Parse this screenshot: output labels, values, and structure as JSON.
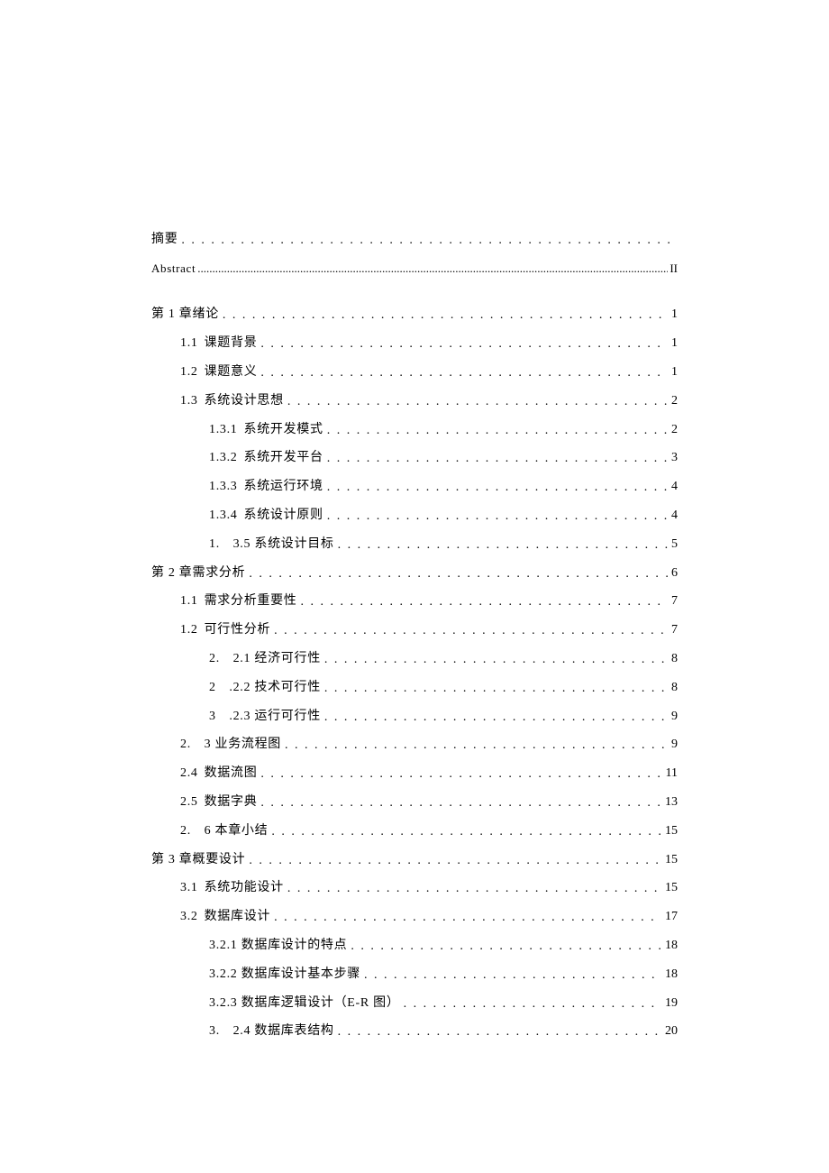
{
  "toc": [
    {
      "level": 0,
      "label": "摘要",
      "title": "",
      "page": "",
      "dots": "sparse",
      "gap": false
    },
    {
      "level": 0,
      "label": "Abstract",
      "title": "",
      "page": "II",
      "dots": "dense",
      "gap": true,
      "cls": "abstract-line"
    },
    {
      "level": 0,
      "label": "第 1 章绪论",
      "title": "",
      "page": "1",
      "dots": "sparse",
      "gap": false
    },
    {
      "level": 1,
      "label": "1.1",
      "title": "课题背景",
      "page": "1",
      "dots": "sparse",
      "gap": false
    },
    {
      "level": 1,
      "label": "1.2",
      "title": "课题意义",
      "page": "1",
      "dots": "sparse",
      "gap": false
    },
    {
      "level": 1,
      "label": "1.3",
      "title": "系统设计思想",
      "page": "2",
      "dots": "sparse",
      "gap": false
    },
    {
      "level": 2,
      "label": "1.3.1",
      "title": "系统开发模式",
      "page": "2",
      "dots": "sparse",
      "gap": false
    },
    {
      "level": 2,
      "label": "1.3.2",
      "title": "系统开发平台",
      "page": "3",
      "dots": "sparse",
      "gap": false
    },
    {
      "level": 2,
      "label": "1.3.3",
      "title": "系统运行环境",
      "page": "4",
      "dots": "sparse",
      "gap": false
    },
    {
      "level": 2,
      "label": "1.3.4",
      "title": "系统设计原则",
      "page": "4",
      "dots": "sparse",
      "gap": false
    },
    {
      "level": 2,
      "label": "1. 3.5 系统设计目标",
      "title": "",
      "page": "5",
      "dots": "sparse",
      "gap": false
    },
    {
      "level": 0,
      "label": "第 2 章需求分析",
      "title": "",
      "page": "6",
      "dots": "sparse",
      "gap": false
    },
    {
      "level": 1,
      "label": "1.1",
      "title": "需求分析重要性",
      "page": "7",
      "dots": "sparse",
      "gap": false
    },
    {
      "level": 1,
      "label": "1.2",
      "title": "可行性分析",
      "page": "7",
      "dots": "sparse",
      "gap": false
    },
    {
      "level": 2,
      "label": "2. 2.1 经济可行性",
      "title": "",
      "page": "8",
      "dots": "sparse",
      "gap": false
    },
    {
      "level": 2,
      "label": "2 .2.2 技术可行性",
      "title": "",
      "page": "8",
      "dots": "sparse",
      "gap": false
    },
    {
      "level": 2,
      "label": "3 .2.3 运行可行性",
      "title": "",
      "page": "9",
      "dots": "sparse",
      "gap": false
    },
    {
      "level": 1,
      "label": "2. 3 业务流程图",
      "title": "",
      "page": "9",
      "dots": "sparse",
      "gap": false
    },
    {
      "level": 1,
      "label": "2.4",
      "title": "数据流图",
      "page": "11",
      "dots": "sparse",
      "gap": false
    },
    {
      "level": 1,
      "label": "2.5",
      "title": "数据字典",
      "page": "13",
      "dots": "sparse",
      "gap": false
    },
    {
      "level": 1,
      "label": "2. 6 本章小结",
      "title": "",
      "page": "15",
      "dots": "sparse",
      "gap": false
    },
    {
      "level": 0,
      "label": "第 3 章概要设计",
      "title": "",
      "page": "15",
      "dots": "sparse",
      "gap": false
    },
    {
      "level": 1,
      "label": "3.1",
      "title": "系统功能设计",
      "page": "15",
      "dots": "sparse",
      "gap": false
    },
    {
      "level": 1,
      "label": "3.2",
      "title": "数据库设计",
      "page": "17",
      "dots": "sparse",
      "gap": false
    },
    {
      "level": 2,
      "label": "3.2.1 数据库设计的特点",
      "title": "",
      "page": "18",
      "dots": "sparse",
      "gap": false
    },
    {
      "level": 2,
      "label": "3.2.2 数据库设计基本步骤",
      "title": "",
      "page": "18",
      "dots": "sparse",
      "gap": false
    },
    {
      "level": 2,
      "label": "3.2.3 数据库逻辑设计（E-R 图）",
      "title": "",
      "page": "19",
      "dots": "sparse",
      "gap": false
    },
    {
      "level": 2,
      "label": "3. 2.4 数据库表结构",
      "title": "",
      "page": "20",
      "dots": "sparse",
      "gap": false
    }
  ]
}
